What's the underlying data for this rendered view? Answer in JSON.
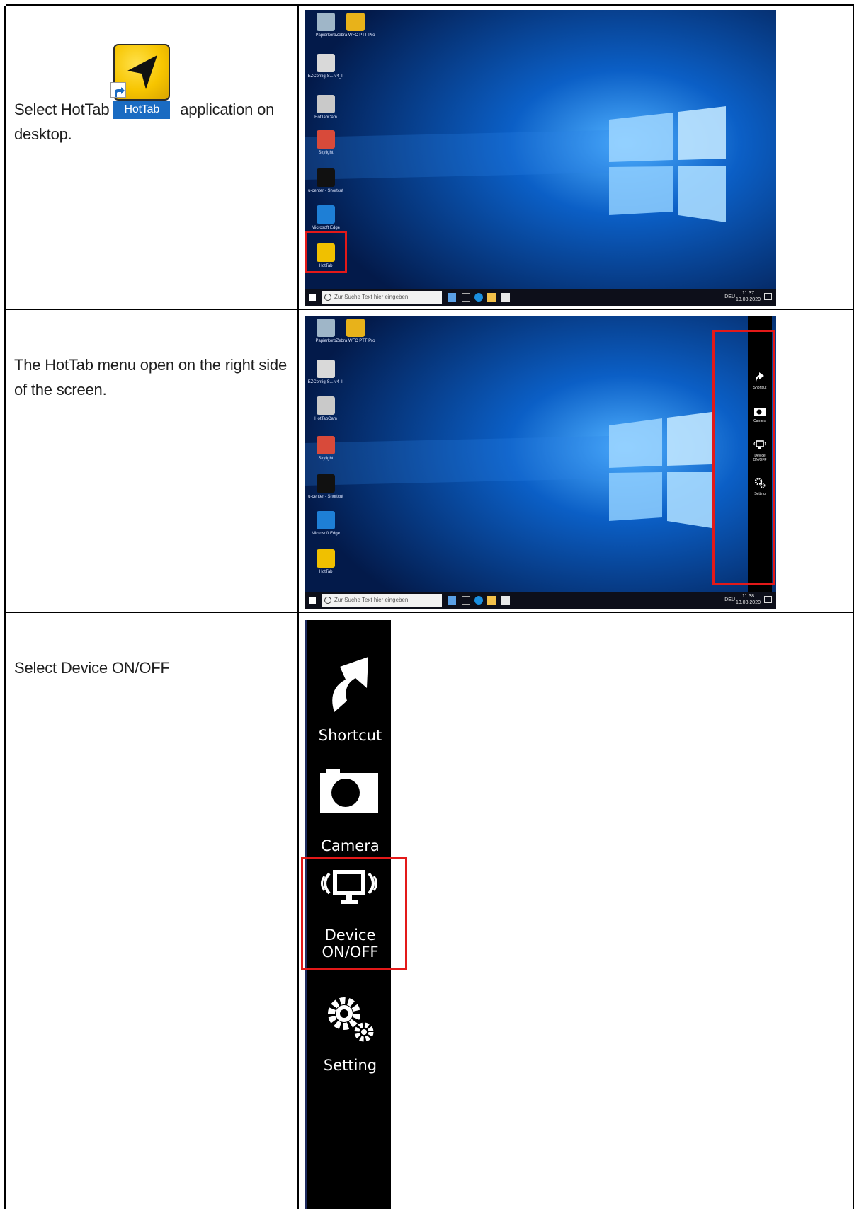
{
  "steps": [
    {
      "text_before": "Select HotTab ",
      "inline_icon_label": "HotTab",
      "text_after": " application on desktop."
    },
    {
      "text": "The HotTab menu open on the right side of the screen."
    },
    {
      "text": "Select Device ON/OFF"
    }
  ],
  "desktop": {
    "icons": [
      {
        "label": "Papierkorb",
        "icon": "recycle-bin-icon"
      },
      {
        "label": "Zebra WFC PTT Pro",
        "icon": "ptt-app-icon"
      },
      {
        "label": "EZConfig-S... v4_II",
        "icon": "ezconfig-icon"
      },
      {
        "label": "HotTabCam",
        "icon": "camera-app-icon"
      },
      {
        "label": "Skylight",
        "icon": "skylight-icon"
      },
      {
        "label": "u-center - Shortcut",
        "icon": "u-center-icon"
      },
      {
        "label": "Microsoft Edge",
        "icon": "edge-icon"
      },
      {
        "label": "HotTab",
        "icon": "hottab-icon"
      }
    ],
    "search_placeholder": "Zur Suche Text hier eingeben",
    "language": "DEU",
    "screenshot1_time": "11:37",
    "screenshot2_time": "11:38",
    "date": "13.08.2020"
  },
  "hottab_menu": {
    "items": [
      {
        "label": "Shortcut",
        "icon": "shortcut-arrow-icon"
      },
      {
        "label": "Camera",
        "icon": "camera-icon"
      },
      {
        "label": "Device ON/OFF",
        "line1": "Device",
        "line2": "ON/OFF",
        "icon": "monitor-wireless-icon"
      },
      {
        "label": "Setting",
        "icon": "gears-icon"
      }
    ]
  },
  "colors": {
    "highlight": "#e31919",
    "hottab_yellow": "#f7c500",
    "menu_bg": "#000000",
    "desktop_bg": "#062a6a"
  }
}
